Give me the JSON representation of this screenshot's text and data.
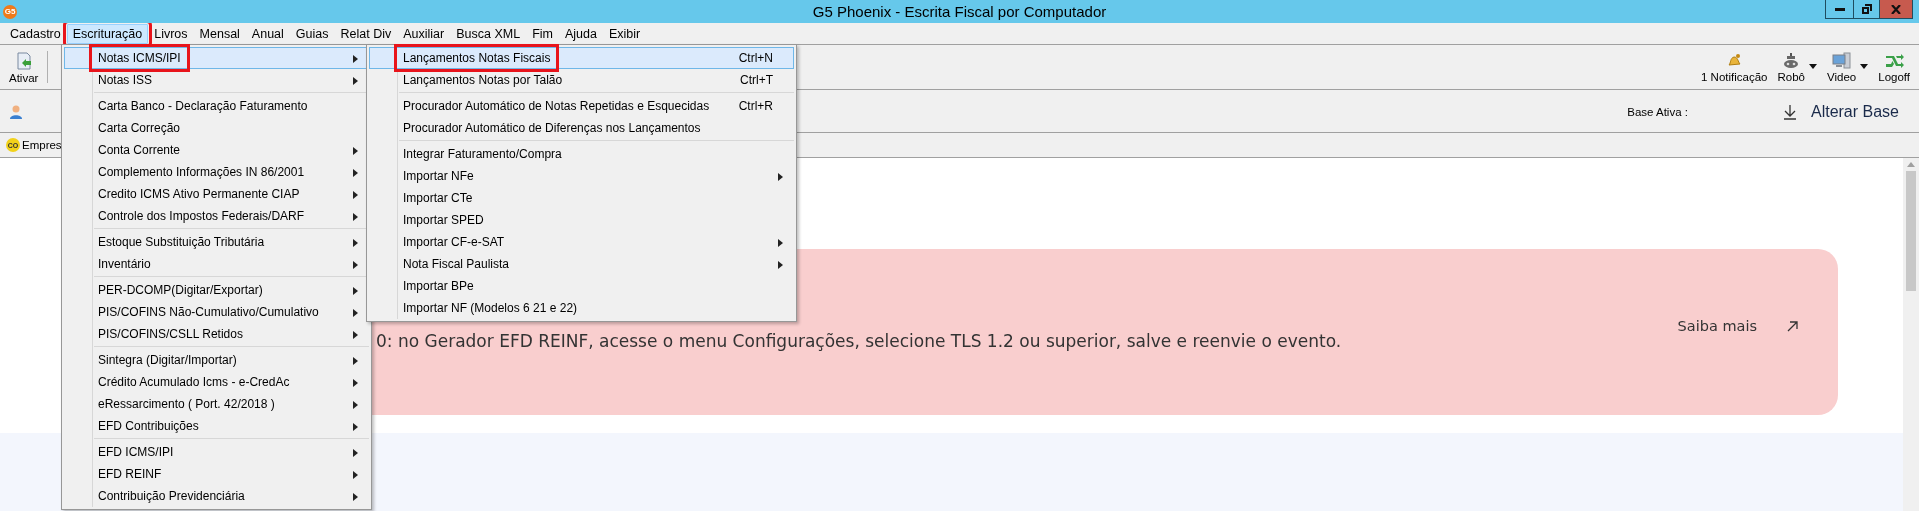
{
  "window": {
    "title": "G5 Phoenix - Escrita Fiscal por Computador",
    "logo_text": "G5"
  },
  "menu_bar": [
    {
      "label": "Cadastro",
      "selected": false,
      "highlighted": false
    },
    {
      "label": "Escrituração",
      "selected": true,
      "highlighted": true
    },
    {
      "label": "Livros",
      "selected": false,
      "highlighted": false
    },
    {
      "label": "Mensal",
      "selected": false,
      "highlighted": false
    },
    {
      "label": "Anual",
      "selected": false,
      "highlighted": false
    },
    {
      "label": "Guias",
      "selected": false,
      "highlighted": false
    },
    {
      "label": "Relat Div",
      "selected": false,
      "highlighted": false
    },
    {
      "label": "Auxiliar",
      "selected": false,
      "highlighted": false
    },
    {
      "label": "Busca XML",
      "selected": false,
      "highlighted": false
    },
    {
      "label": "Fim",
      "selected": false,
      "highlighted": false
    },
    {
      "label": "Ajuda",
      "selected": false,
      "highlighted": false
    },
    {
      "label": "Exibir",
      "selected": false,
      "highlighted": false
    }
  ],
  "toolbar": {
    "left": [
      {
        "label": "Ativar",
        "kind": "activate"
      }
    ],
    "right": [
      {
        "label": "1 Notificação",
        "kind": "bell",
        "dropdown": false
      },
      {
        "label": "Robô",
        "kind": "robot",
        "dropdown": true
      },
      {
        "label": "Video",
        "kind": "monitor",
        "dropdown": true
      },
      {
        "label": "Logoff",
        "kind": "logoff",
        "dropdown": false
      }
    ]
  },
  "info_bar": {
    "base_label": "Base Ativa :",
    "change_base": "Alterar Base"
  },
  "tab_bar": {
    "tab": "Empres",
    "icon_text": "CO"
  },
  "banner": {
    "text": "0: no Gerador EFD REINF, acesse o menu Configurações, selecione TLS 1.2 ou superior, salve e reenvie o evento.",
    "link": "Saiba mais"
  },
  "menu": [
    [
      {
        "label": "Notas ICMS/IPI",
        "submenu": true,
        "selected": true,
        "highlighted": true
      },
      {
        "label": "Notas ISS",
        "submenu": true,
        "selected": false,
        "highlighted": false
      }
    ],
    [
      {
        "label": "Carta Banco - Declaração Faturamento",
        "submenu": false,
        "selected": false,
        "highlighted": false
      },
      {
        "label": "Carta Correção",
        "submenu": false,
        "selected": false,
        "highlighted": false
      },
      {
        "label": "Conta Corrente",
        "submenu": true,
        "selected": false,
        "highlighted": false
      },
      {
        "label": "Complemento Informações IN 86/2001",
        "submenu": true,
        "selected": false,
        "highlighted": false
      },
      {
        "label": "Credito ICMS Ativo Permanente CIAP",
        "submenu": true,
        "selected": false,
        "highlighted": false
      },
      {
        "label": "Controle dos Impostos Federais/DARF",
        "submenu": true,
        "selected": false,
        "highlighted": false
      }
    ],
    [
      {
        "label": "Estoque Substituição Tributária",
        "submenu": true,
        "selected": false,
        "highlighted": false
      },
      {
        "label": "Inventário",
        "submenu": true,
        "selected": false,
        "highlighted": false
      }
    ],
    [
      {
        "label": "PER-DCOMP(Digitar/Exportar)",
        "submenu": true,
        "selected": false,
        "highlighted": false
      },
      {
        "label": "PIS/COFINS Não-Cumulativo/Cumulativo",
        "submenu": true,
        "selected": false,
        "highlighted": false
      },
      {
        "label": "PIS/COFINS/CSLL Retidos",
        "submenu": true,
        "selected": false,
        "highlighted": false
      }
    ],
    [
      {
        "label": "Sintegra (Digitar/Importar)",
        "submenu": true,
        "selected": false,
        "highlighted": false
      },
      {
        "label": "Crédito Acumulado Icms - e-CredAc",
        "submenu": true,
        "selected": false,
        "highlighted": false
      },
      {
        "label": "eRessarcimento ( Port. 42/2018 )",
        "submenu": true,
        "selected": false,
        "highlighted": false
      },
      {
        "label": "EFD Contribuições",
        "submenu": true,
        "selected": false,
        "highlighted": false
      }
    ],
    [
      {
        "label": "EFD ICMS/IPI",
        "submenu": true,
        "selected": false,
        "highlighted": false
      },
      {
        "label": "EFD REINF",
        "submenu": true,
        "selected": false,
        "highlighted": false
      },
      {
        "label": "Contribuição Previdenciária",
        "submenu": true,
        "selected": false,
        "highlighted": false
      }
    ]
  ],
  "submenu": [
    [
      {
        "label": "Lançamentos Notas Fiscais",
        "shortcut": "Ctrl+N",
        "submenu": false,
        "selected": true,
        "highlighted": true
      },
      {
        "label": "Lançamentos Notas por Talão",
        "shortcut": "Ctrl+T",
        "submenu": false,
        "selected": false,
        "highlighted": false
      }
    ],
    [
      {
        "label": "Procurador Automático de Notas Repetidas e Esquecidas",
        "shortcut": "Ctrl+R",
        "submenu": false,
        "selected": false,
        "highlighted": false
      },
      {
        "label": "Procurador Automático de Diferenças nos Lançamentos",
        "submenu": false,
        "selected": false,
        "highlighted": false
      }
    ],
    [
      {
        "label": "Integrar Faturamento/Compra",
        "submenu": false,
        "selected": false,
        "highlighted": false
      },
      {
        "label": "Importar NFe",
        "submenu": true,
        "selected": false,
        "highlighted": false
      },
      {
        "label": "Importar CTe",
        "submenu": false,
        "selected": false,
        "highlighted": false
      },
      {
        "label": "Importar SPED",
        "submenu": false,
        "selected": false,
        "highlighted": false
      },
      {
        "label": "Importar CF-e-SAT",
        "submenu": true,
        "selected": false,
        "highlighted": false
      },
      {
        "label": "Nota Fiscal Paulista",
        "submenu": true,
        "selected": false,
        "highlighted": false
      },
      {
        "label": "Importar BPe",
        "submenu": false,
        "selected": false,
        "highlighted": false
      },
      {
        "label": "Importar NF (Modelos 6 21 e 22)",
        "submenu": false,
        "selected": false,
        "highlighted": false
      }
    ]
  ]
}
